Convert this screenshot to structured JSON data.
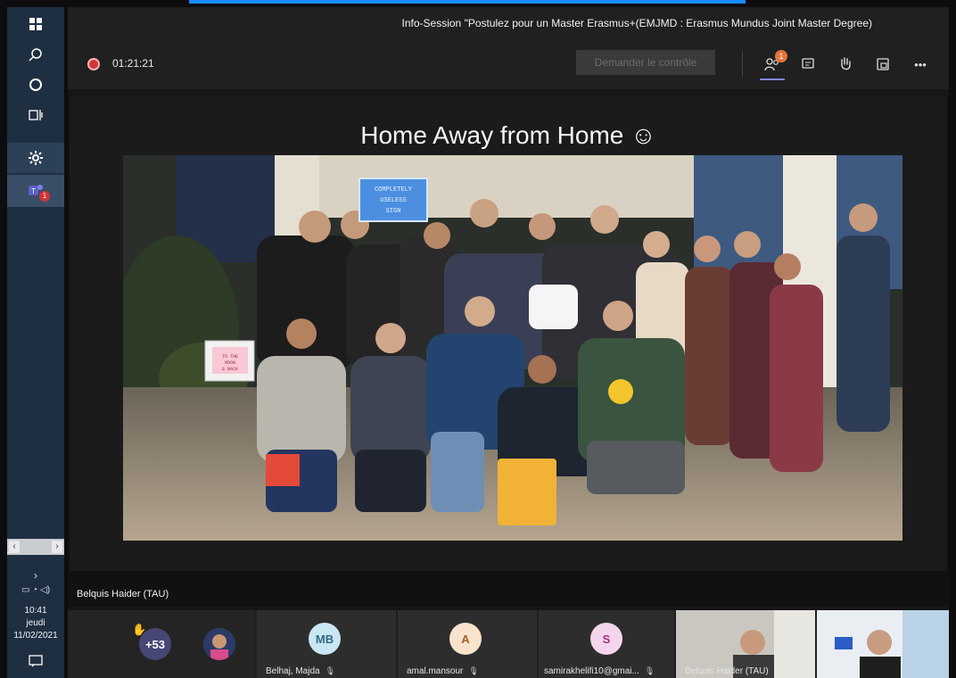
{
  "window": {
    "title": "Info-Session \"Postulez pour un Master Erasmus+(EMJMD : Erasmus Mundus Joint Master Degree)"
  },
  "toolbar": {
    "recording_time": "01:21:21",
    "request_control_label": "Demander le contrôle",
    "participants_badge": "1",
    "more_label": "•••"
  },
  "taskbar": {
    "teams_badge": "1",
    "clock_time": "10:41",
    "clock_day": "jeudi",
    "clock_date": "11/02/2021"
  },
  "slide": {
    "title": "Home Away from Home ☺",
    "sign_text": "COMPLETELY USELESS SIGN",
    "small_sign_text": "TO THE MOON & BACK"
  },
  "presenter": {
    "name": "Belquis Haider (TAU)"
  },
  "participants": {
    "overflow_count": "+53",
    "tiles": [
      {
        "initials": "MB",
        "name": "Belhaj, Majda",
        "color": "#c9e6f2"
      },
      {
        "initials": "A",
        "name": "amal.mansour",
        "color": "#f9e3cc"
      },
      {
        "initials": "S",
        "name": "samirakhelifi10@gmai...",
        "color": "#f4d6ec"
      },
      {
        "initials": "",
        "name": "Belquis Haider (TAU)",
        "color": ""
      }
    ]
  }
}
